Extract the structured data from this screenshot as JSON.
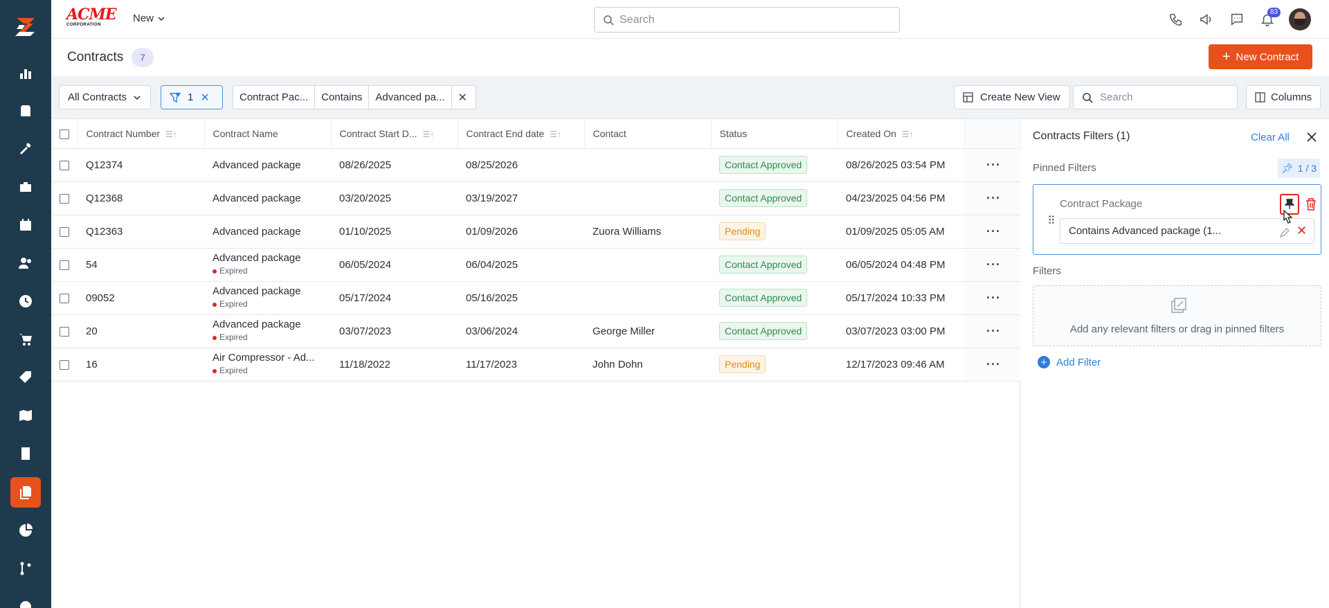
{
  "topbar": {
    "brand_name": "ACME",
    "brand_sub": "CORPORATION",
    "new_label": "New",
    "search_placeholder": "Search",
    "notification_count": "83"
  },
  "page": {
    "title": "Contracts",
    "count": "7",
    "new_button_label": "New Contract"
  },
  "filterbar": {
    "view_select": "All Contracts",
    "filter_count": "1",
    "chip": {
      "field": "Contract Pac...",
      "operator": "Contains",
      "value": "Advanced pa..."
    },
    "create_view_label": "Create New View",
    "search_placeholder": "Search",
    "columns_label": "Columns"
  },
  "table": {
    "headers": [
      "Contract Number",
      "Contract Name",
      "Contract Start D...",
      "Contract End date",
      "Contact",
      "Status",
      "Created On"
    ],
    "rows": [
      {
        "number": "Q12374",
        "name": "Advanced package",
        "sub": "",
        "start": "08/26/2025",
        "end": "08/25/2026",
        "contact": "",
        "status": "Contact Approved",
        "status_type": "approved",
        "created": "08/26/2025 03:54 PM"
      },
      {
        "number": "Q12368",
        "name": "Advanced package",
        "sub": "",
        "start": "03/20/2025",
        "end": "03/19/2027",
        "contact": "",
        "status": "Contact Approved",
        "status_type": "approved",
        "created": "04/23/2025 04:56 PM"
      },
      {
        "number": "Q12363",
        "name": "Advanced package",
        "sub": "",
        "start": "01/10/2025",
        "end": "01/09/2026",
        "contact": "Zuora Williams",
        "status": "Pending",
        "status_type": "pending",
        "created": "01/09/2025 05:05 AM"
      },
      {
        "number": "54",
        "name": "Advanced package",
        "sub": "Expired",
        "start": "06/05/2024",
        "end": "06/04/2025",
        "contact": "",
        "status": "Contact Approved",
        "status_type": "approved",
        "created": "06/05/2024 04:48 PM"
      },
      {
        "number": "09052",
        "name": "Advanced package",
        "sub": "Expired",
        "start": "05/17/2024",
        "end": "05/16/2025",
        "contact": "",
        "status": "Contact Approved",
        "status_type": "approved",
        "created": "05/17/2024 10:33 PM"
      },
      {
        "number": "20",
        "name": "Advanced package",
        "sub": "Expired",
        "start": "03/07/2023",
        "end": "03/06/2024",
        "contact": "George Miller",
        "status": "Contact Approved",
        "status_type": "approved",
        "created": "03/07/2023 03:00 PM"
      },
      {
        "number": "16",
        "name": "Air Compressor - Ad...",
        "sub": "Expired",
        "start": "11/18/2022",
        "end": "11/17/2023",
        "contact": "John Dohn",
        "status": "Pending",
        "status_type": "pending",
        "created": "12/17/2023 09:46 AM"
      }
    ]
  },
  "panel": {
    "title": "Contracts Filters (1)",
    "clear_all": "Clear All",
    "pinned_label": "Pinned Filters",
    "pin_count": "1 / 3",
    "pinned_filter": {
      "label": "Contract Package",
      "value": "Contains Advanced package (1..."
    },
    "filters_label": "Filters",
    "dropzone_text": "Add any relevant filters or drag in pinned filters",
    "add_filter": "Add Filter"
  },
  "colors": {
    "rail": "#1f3a4d",
    "accent": "#e8501e",
    "link": "#2f7fd9",
    "approved": "#2e8b4f",
    "pending": "#d88b1a"
  },
  "rail_icons": [
    "logo-icon",
    "chart-icon",
    "clipboard-icon",
    "tools-icon",
    "briefcase-icon",
    "calendar-icon",
    "users-icon",
    "clock-icon",
    "cart-icon",
    "tag-icon",
    "map-icon",
    "calculator-icon",
    "contracts-icon",
    "pie-chart-icon",
    "branch-icon",
    "settings-icon"
  ]
}
